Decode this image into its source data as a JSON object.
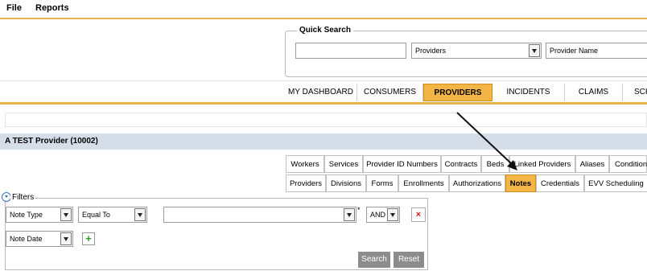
{
  "menubar": {
    "items": [
      "File",
      "Reports"
    ]
  },
  "quick_search": {
    "title": "Quick Search",
    "search_value": "",
    "category": "Providers",
    "field": "Provider Name"
  },
  "nav": {
    "tabs": [
      "MY DASHBOARD",
      "CONSUMERS",
      "PROVIDERS",
      "INCIDENTS",
      "CLAIMS",
      "SCH"
    ],
    "active": "PROVIDERS"
  },
  "provider": {
    "title": "A TEST Provider (10002)"
  },
  "record_tabs": {
    "row1": [
      "Workers",
      "Services",
      "Provider ID Numbers",
      "Contracts",
      "Beds",
      "Linked Providers",
      "Aliases",
      "Conditions"
    ],
    "row2": [
      "Providers",
      "Divisions",
      "Forms",
      "Enrollments",
      "Authorizations",
      "Notes",
      "Credentials",
      "EVV Scheduling"
    ],
    "active": "Notes"
  },
  "filters": {
    "legend": "Filters",
    "row1": {
      "field": "Note Type",
      "operator": "Equal To",
      "value": "",
      "required_mark": "*",
      "join": "AND"
    },
    "row2": {
      "field": "Note Date"
    },
    "remove_glyph": "×",
    "add_glyph": "+",
    "search_label": "Search",
    "reset_label": "Reset"
  },
  "colors": {
    "accent": "#f3b646",
    "header_line": "#e8b24c",
    "provider_bar": "#d5dde8",
    "remove": "#d01c1c",
    "add": "#2e9a2e"
  }
}
